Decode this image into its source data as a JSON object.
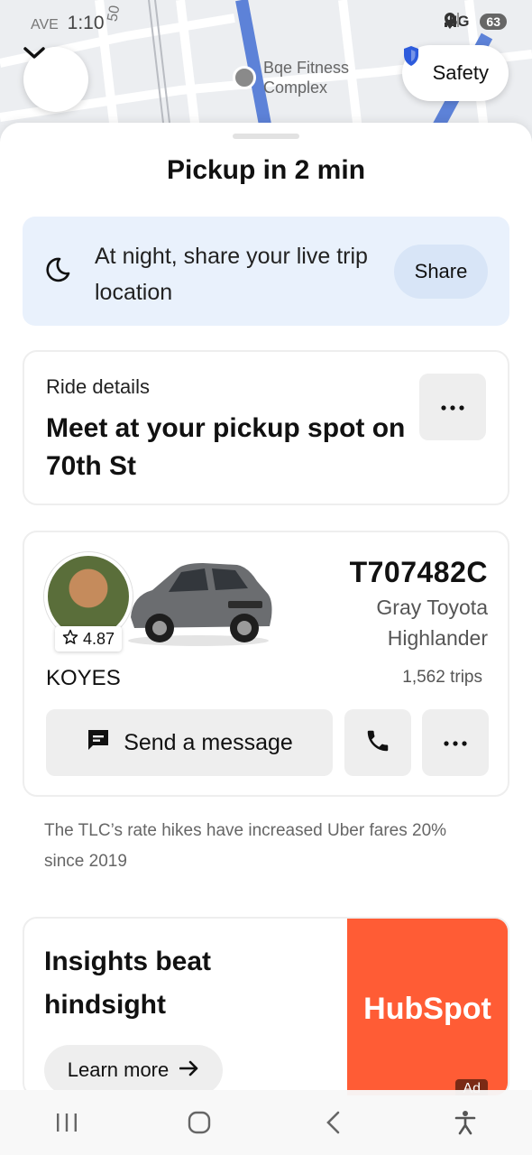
{
  "status_bar": {
    "time": "1:10",
    "network": "5G",
    "battery": "63"
  },
  "map": {
    "poi_name": "Bqe Fitness Complex",
    "street_label_top": "AVE",
    "street_number": "50"
  },
  "safety_button": {
    "label": "Safety"
  },
  "sheet": {
    "title": "Pickup in 2 min"
  },
  "share_card": {
    "message": "At night, share your live trip location",
    "button_label": "Share"
  },
  "ride_details": {
    "label": "Ride details",
    "headline": "Meet at your pickup spot on 70th St"
  },
  "driver": {
    "name": "KOYES",
    "rating": "4.87",
    "plate": "T707482C",
    "car_model": "Gray Toyota Highlander",
    "trips": "1,562 trips",
    "message_button": "Send a message"
  },
  "notice": "The TLC’s rate hikes have increased Uber fares 20% since 2019",
  "ad": {
    "headline": "Insights beat hindsight",
    "cta": "Learn more",
    "brand": "HubSpot",
    "badge": "Ad"
  },
  "colors": {
    "accent_blue": "#2d5bdc",
    "share_card_bg": "#e9f1fc",
    "ad_bg": "#ff5c35"
  }
}
